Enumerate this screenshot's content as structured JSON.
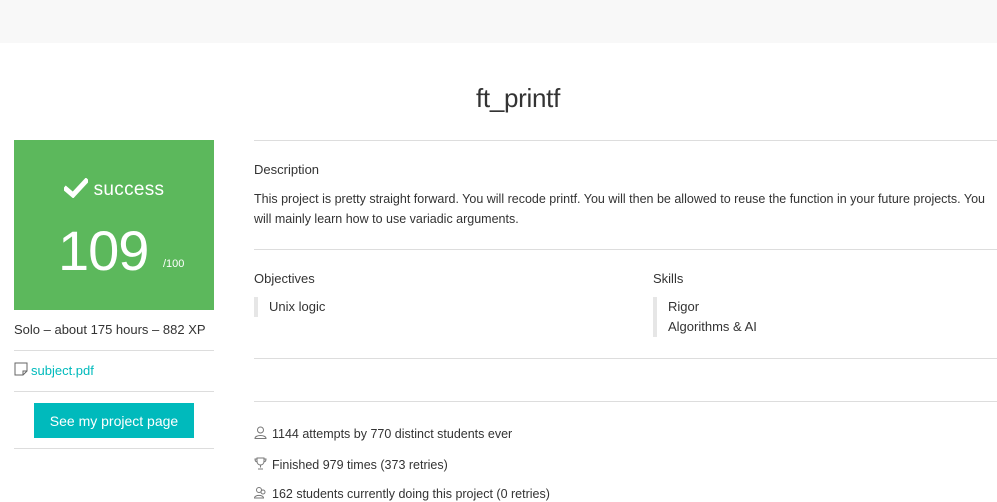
{
  "project": {
    "title": "ft_printf"
  },
  "score": {
    "status": "success",
    "value": "109",
    "max": "/100",
    "color": "#5cb85c"
  },
  "meta": "Solo – about 175 hours – 882 XP",
  "subject": {
    "link_label": "subject.pdf",
    "icon": "document-icon"
  },
  "project_button_label": "See my project page",
  "description": {
    "heading": "Description",
    "text": "This project is pretty straight forward. You will recode printf. You will then be allowed to reuse the function in your future projects. You will mainly learn how to use variadic arguments."
  },
  "objectives": {
    "heading": "Objectives",
    "items": [
      "Unix logic"
    ]
  },
  "skills": {
    "heading": "Skills",
    "items": [
      "Rigor",
      "Algorithms & AI"
    ]
  },
  "stats": [
    {
      "icon": "user-icon",
      "text": "1144 attempts by 770 distinct students ever"
    },
    {
      "icon": "trophy-icon",
      "text": "Finished 979 times (373 retries)"
    },
    {
      "icon": "users-icon",
      "text": "162 students currently doing this project (0 retries)"
    }
  ],
  "colors": {
    "accent": "#00babc",
    "success": "#5cb85c"
  }
}
